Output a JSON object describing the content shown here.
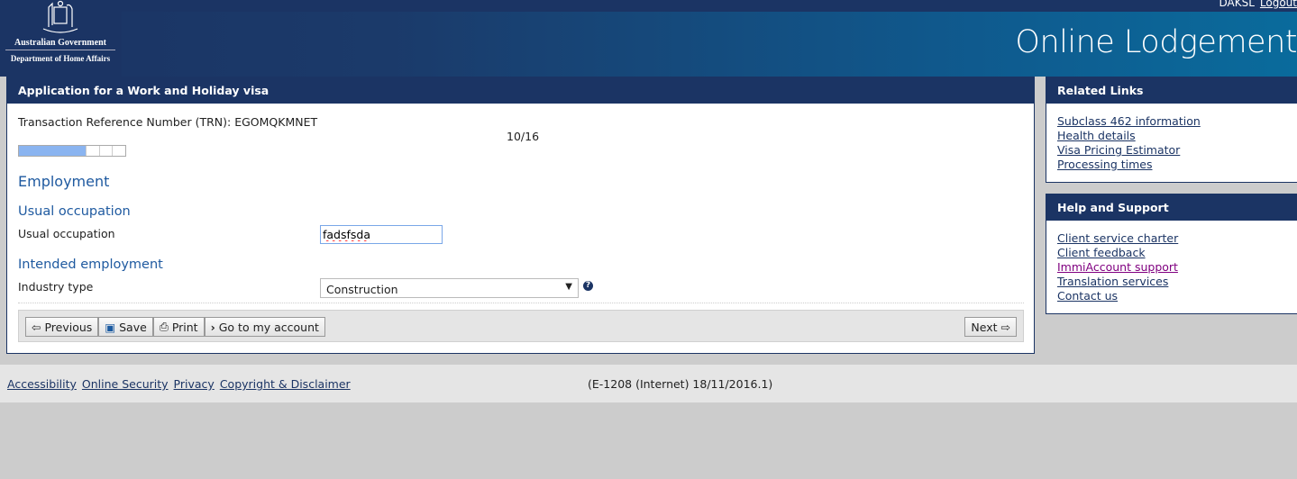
{
  "header": {
    "gov": "Australian Government",
    "dept": "Department of Home Affairs",
    "username": "DAKSL",
    "logout": "Logout",
    "app_title": "Online Lodgement"
  },
  "main": {
    "title": "Application for a Work and Holiday visa",
    "trn_label": "Transaction Reference Number (TRN): EGOMQKMNET",
    "progress": {
      "current": 10,
      "total": 16,
      "text": "10/16"
    },
    "section": "Employment",
    "usual": {
      "heading": "Usual occupation",
      "label": "Usual occupation",
      "value": "fadsfsda"
    },
    "intended": {
      "heading": "Intended employment",
      "label": "Industry type",
      "value": "Construction"
    },
    "buttons": {
      "previous": "Previous",
      "save": "Save",
      "print": "Print",
      "account": "Go to my account",
      "next": "Next"
    }
  },
  "sidebar": {
    "related": {
      "title": "Related Links",
      "items": [
        "Subclass 462 information",
        "Health details",
        "Visa Pricing Estimator",
        "Processing times"
      ]
    },
    "help": {
      "title": "Help and Support",
      "items": [
        "Client service charter",
        "Client feedback",
        "ImmiAccount support",
        "Translation services",
        "Contact us"
      ]
    }
  },
  "footer": {
    "links": [
      "Accessibility",
      "Online Security",
      "Privacy",
      "Copyright & Disclaimer"
    ],
    "version": "(E-1208 (Internet) 18/11/2016.1)"
  },
  "colors": {
    "navy": "#1b3464",
    "heading_blue": "#1f5aa0",
    "progress": "#8ab4f0",
    "visited": "#800080"
  }
}
